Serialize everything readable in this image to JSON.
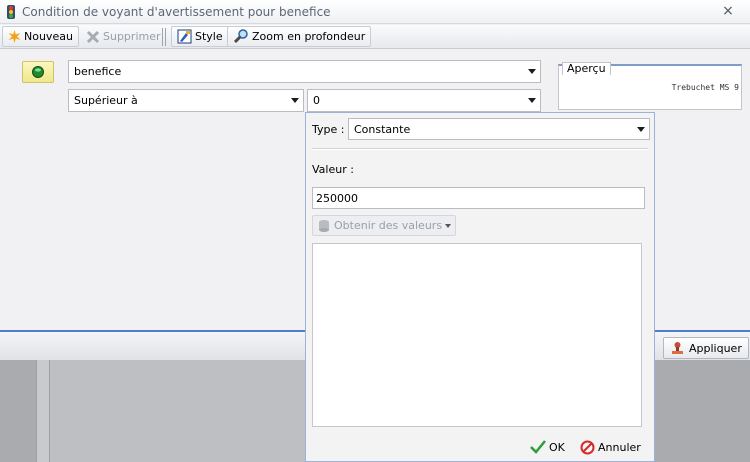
{
  "window": {
    "title": "Condition de voyant d'avertissement  pour  benefice",
    "close_glyph": "×"
  },
  "toolbar": {
    "new_label": "Nouveau",
    "delete_label": "Supprimer",
    "style_label": "Style",
    "zoom_label": "Zoom en profondeur"
  },
  "condition": {
    "field_value": "benefice",
    "operator_value": "Supérieur à",
    "compare_value": "0"
  },
  "preview": {
    "legend": "Aperçu",
    "font_text": "Trebuchet MS 9"
  },
  "popup": {
    "type_label": "Type :",
    "type_value": "Constante",
    "value_label": "Valeur :",
    "value_input": "250000",
    "obtain_label": "Obtenir des valeurs",
    "ok_label": "OK",
    "cancel_label": "Annuler"
  },
  "footer": {
    "apply_label": "Appliquer"
  },
  "icons": {
    "app": "traffic-light-icon",
    "new": "starburst-icon",
    "delete": "x-icon",
    "style": "paintbrush-icon",
    "zoom": "magnifier-icon",
    "light": "green-light-icon",
    "apply": "stamp-icon",
    "ok": "checkmark-icon",
    "cancel": "no-entry-icon"
  },
  "colors": {
    "accent_blue": "#4d7fd0",
    "indicator_yellow": "#f0e88a",
    "indicator_green": "#1f8a2e"
  }
}
